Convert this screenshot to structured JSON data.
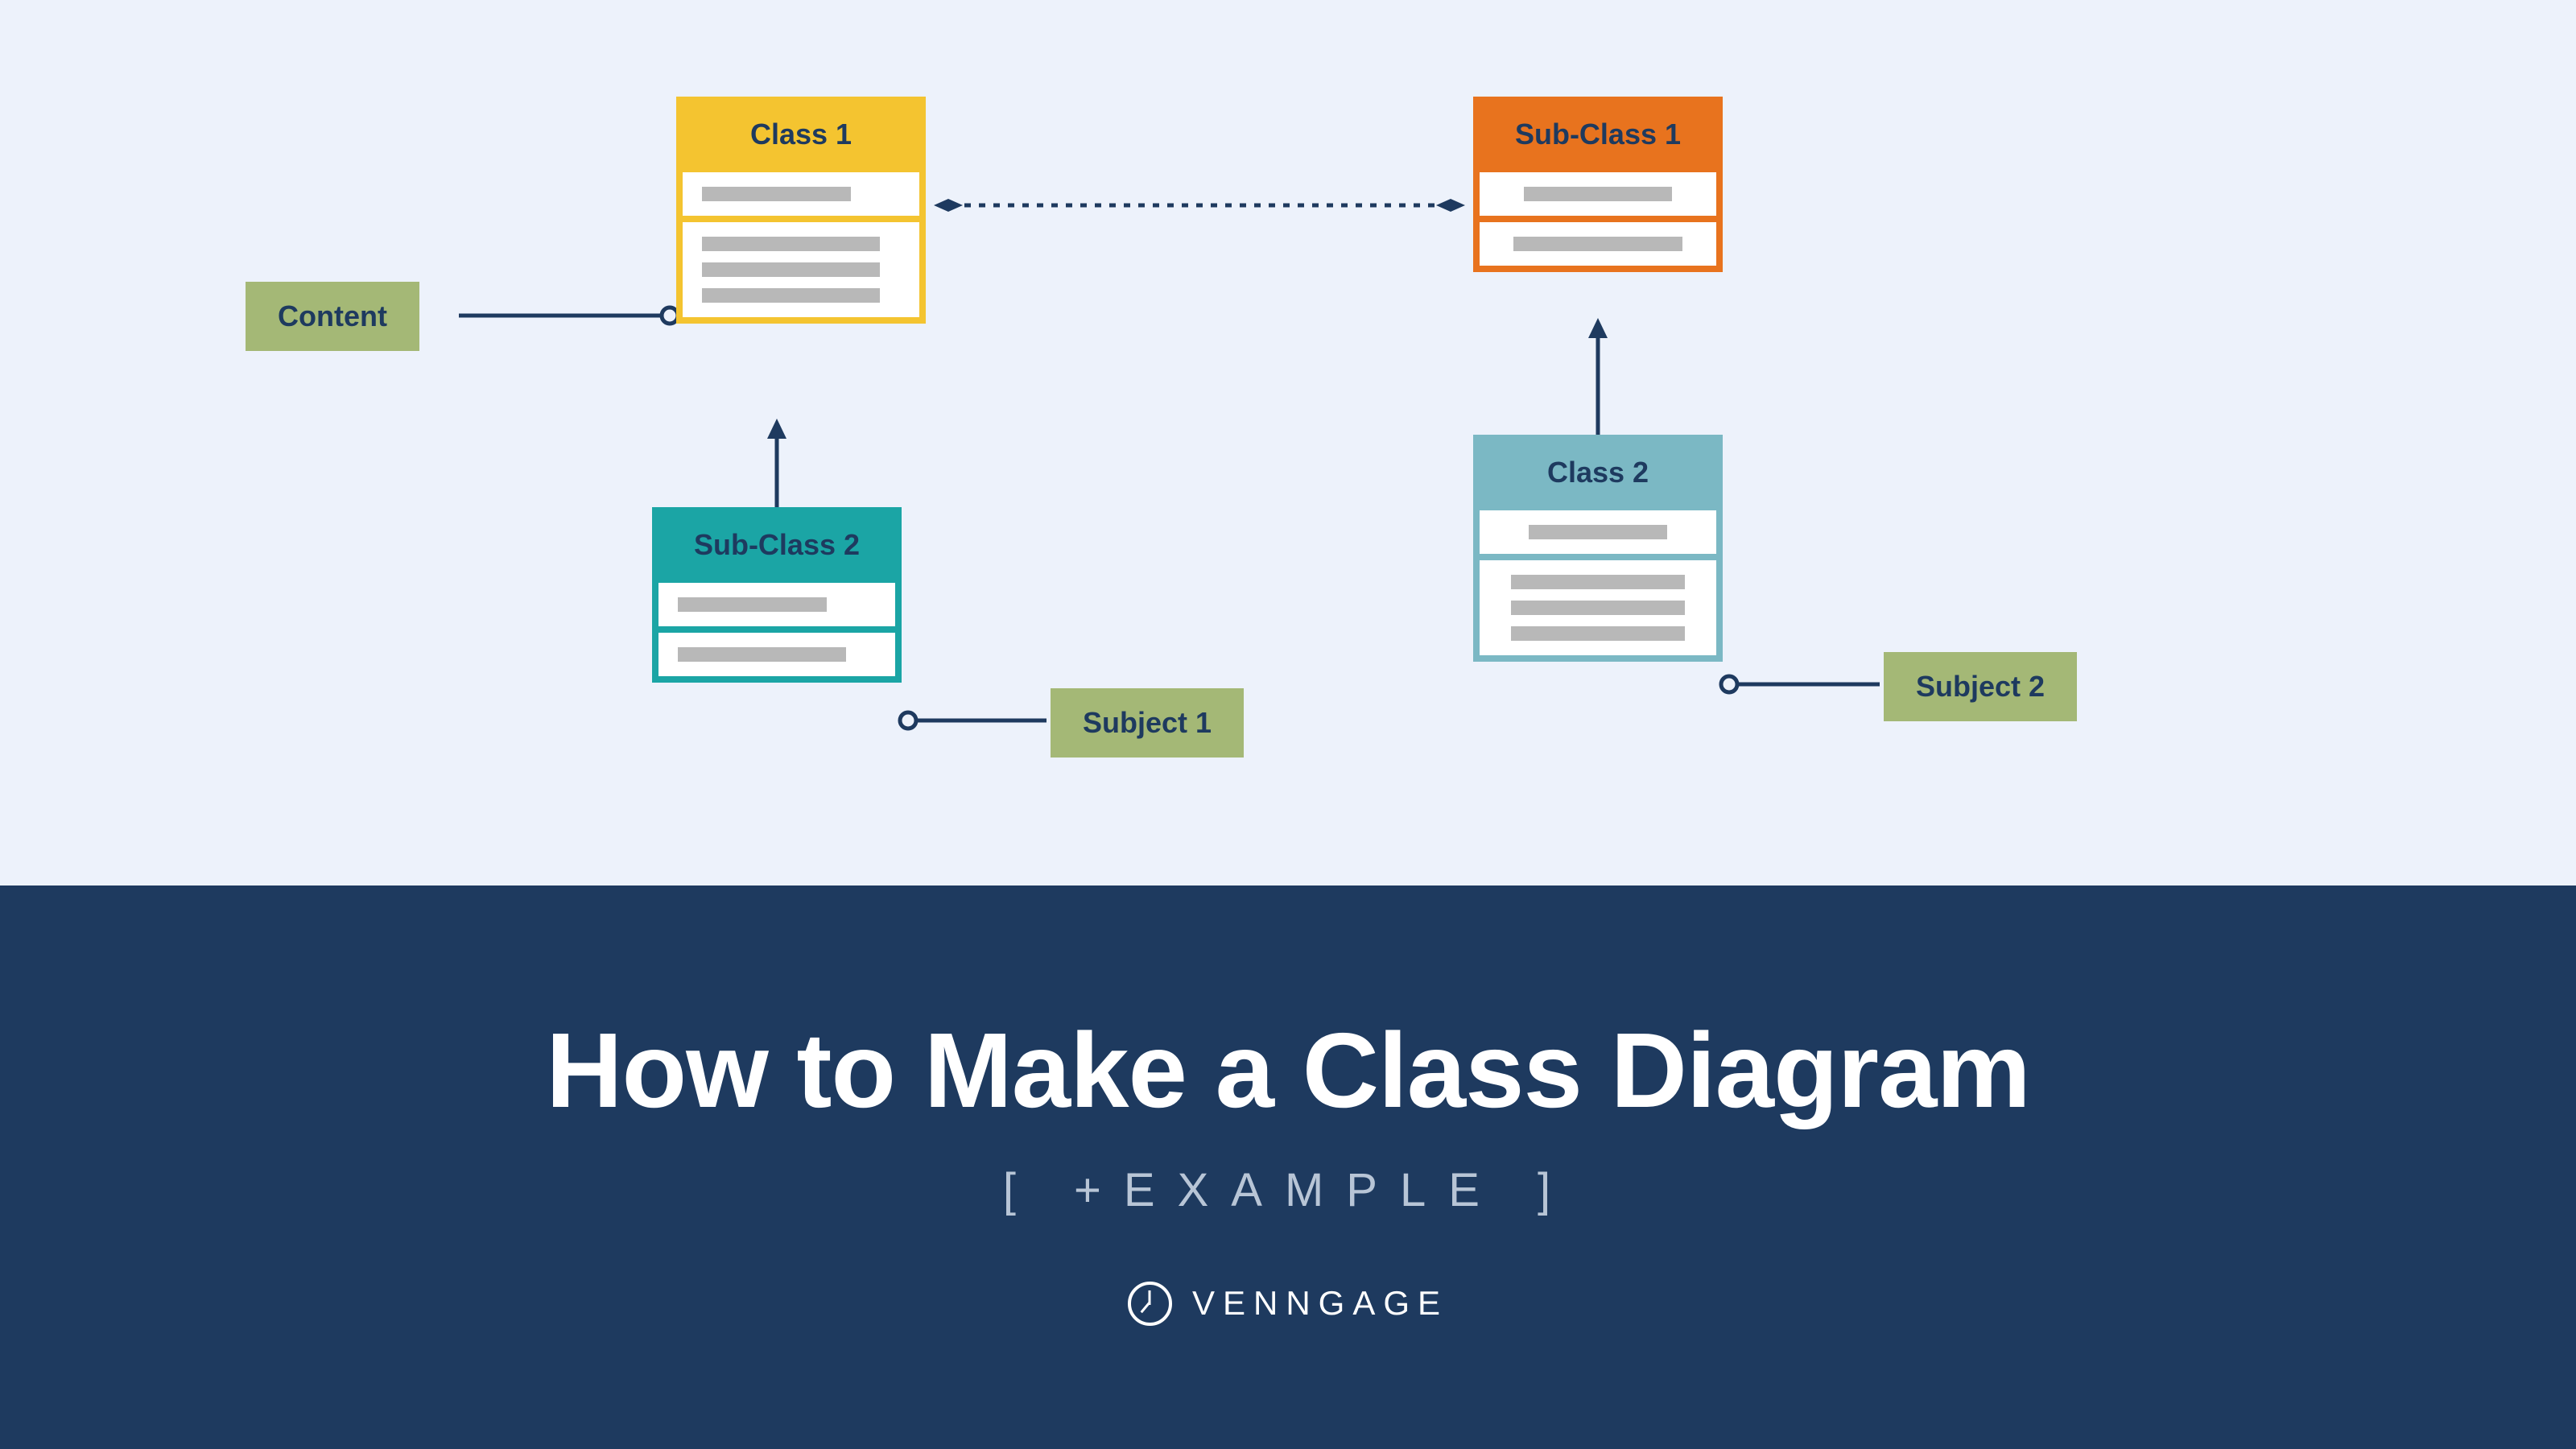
{
  "diagram": {
    "class1": {
      "title": "Class 1",
      "color": "#f4c430"
    },
    "subclass1": {
      "title": "Sub-Class 1",
      "color": "#e8731e"
    },
    "subclass2": {
      "title": "Sub-Class 2",
      "color": "#1ba5a5"
    },
    "class2": {
      "title": "Class 2",
      "color": "#7bb8c4"
    },
    "tags": {
      "content": "Content",
      "subject1": "Subject 1",
      "subject2": "Subject 2"
    }
  },
  "footer": {
    "title": "How to Make a Class Diagram",
    "subtitle": "[ +EXAMPLE ]",
    "brand": "VENNGAGE"
  },
  "colors": {
    "background_light": "#edf2fb",
    "background_dark": "#1e3a5f",
    "tag_green": "#a4b876",
    "line_gray": "#b8b8b8",
    "connector": "#1e3a5f"
  }
}
